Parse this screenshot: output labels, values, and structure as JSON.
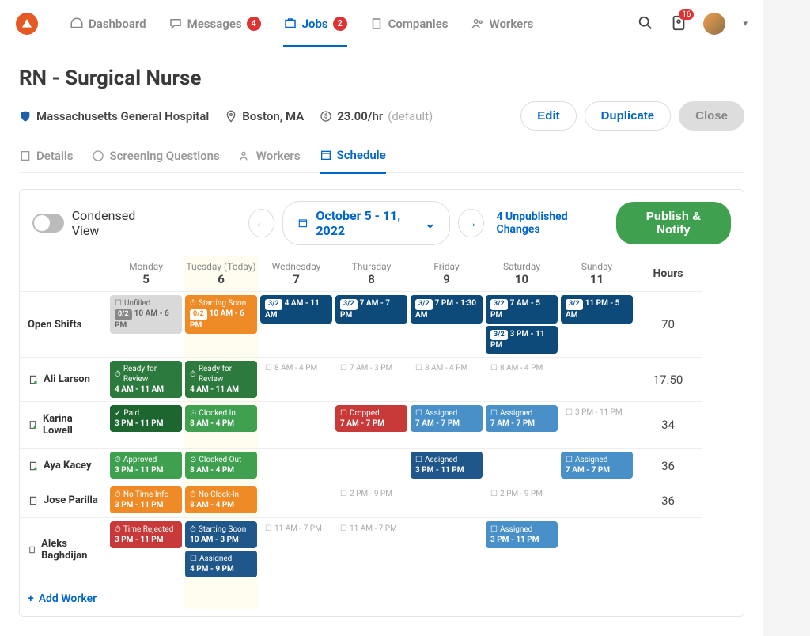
{
  "nav": {
    "dashboard": "Dashboard",
    "messages": "Messages",
    "messages_badge": "4",
    "jobs": "Jobs",
    "jobs_badge": "2",
    "companies": "Companies",
    "workers": "Workers",
    "notif_badge": "16"
  },
  "page": {
    "title": "RN - Surgical Nurse",
    "hospital": "Massachusetts General Hospital",
    "location": "Boston, MA",
    "rate": "23.00/hr",
    "rate_sub": "(default)",
    "edit": "Edit",
    "duplicate": "Duplicate",
    "close": "Close"
  },
  "subtabs": {
    "details": "Details",
    "screening": "Screening Questions",
    "workers": "Workers",
    "schedule": "Schedule"
  },
  "toolbar": {
    "condensed": "Condensed View",
    "range": "October 5 - 11, 2022",
    "unpub": "4 Unpublished Changes",
    "publish": "Publish & Notify"
  },
  "days": [
    {
      "label": "Monday",
      "num": "5"
    },
    {
      "label": "Tuesday (Today)",
      "num": "6"
    },
    {
      "label": "Wednesday",
      "num": "7"
    },
    {
      "label": "Thursday",
      "num": "8"
    },
    {
      "label": "Friday",
      "num": "9"
    },
    {
      "label": "Saturday",
      "num": "10"
    },
    {
      "label": "Sunday",
      "num": "11"
    }
  ],
  "hours_label": "Hours",
  "rows": {
    "open": {
      "label": "Open Shifts",
      "hours": "70",
      "mon": {
        "status": "Unfilled",
        "pill": "0/2",
        "time": "10 AM - 6 PM"
      },
      "tue": {
        "status": "Starting Soon",
        "pill": "0/2",
        "time": "10 AM - 6 PM"
      },
      "wed": {
        "pill": "3/2",
        "time": "4 AM - 11 AM"
      },
      "thu": {
        "pill": "3/2",
        "time": "7 AM - 7 PM"
      },
      "fri": {
        "pill": "3/2",
        "time": "7 PM - 1:30 AM"
      },
      "sat1": {
        "pill": "3/2",
        "time": "7 AM - 5 PM"
      },
      "sat2": {
        "pill": "3/2",
        "time": "3 PM - 11 PM"
      },
      "sun": {
        "pill": "3/2",
        "time": "11 PM - 5 AM"
      }
    },
    "ali": {
      "label": "Ali Larson",
      "hours": "17.50",
      "mon": {
        "status": "Ready for Review",
        "time": "4 AM - 11 AM"
      },
      "tue": {
        "status": "Ready for Review",
        "time": "4 AM - 11 AM"
      },
      "wed": "8 AM - 4 PM",
      "thu": "7 AM - 3 PM",
      "fri": "8 AM - 4 PM",
      "sat": "8 AM - 4 PM"
    },
    "karina": {
      "label": "Karina Lowell",
      "hours": "34",
      "mon": {
        "status": "Paid",
        "time": "3 PM - 11 PM"
      },
      "tue": {
        "status": "Clocked In",
        "time": "8 AM - 4 PM"
      },
      "thu": {
        "status": "Dropped",
        "time": "7 AM - 7 PM"
      },
      "fri": {
        "status": "Assigned",
        "time": "7 AM - 7 PM"
      },
      "sat": {
        "status": "Assigned",
        "time": "7 AM - 7 PM"
      },
      "sun": "3 PM - 11 PM"
    },
    "aya": {
      "label": "Aya Kacey",
      "hours": "36",
      "mon": {
        "status": "Approved",
        "time": "3 PM - 11 PM"
      },
      "tue": {
        "status": "Clocked Out",
        "time": "8 AM - 4 PM"
      },
      "fri": {
        "status": "Assigned",
        "time": "3 PM - 11 PM"
      },
      "sun": {
        "status": "Assigned",
        "time": "7 AM - 7 PM"
      }
    },
    "jose": {
      "label": "Jose Parilla",
      "hours": "36",
      "mon": {
        "status": "No Time Info",
        "time": "3 PM - 11 PM"
      },
      "tue": {
        "status": "No Clock-In",
        "time": "8 AM - 4 PM"
      },
      "thu": "2 PM - 9 PM",
      "sat": "2 PM - 9 PM"
    },
    "aleks": {
      "label": "Aleks Baghdijan",
      "hours": "",
      "mon": {
        "status": "Time Rejected",
        "time": "3 PM - 11 PM"
      },
      "tue1": {
        "status": "Starting Soon",
        "time": "10 AM - 3 PM"
      },
      "tue2": {
        "status": "Assigned",
        "time": "4 PM - 9 PM"
      },
      "wed": "11 AM - 7 PM",
      "thu": "11 AM - 7 PM",
      "sat": {
        "status": "Assigned",
        "time": "3 PM - 11 PM"
      }
    }
  },
  "add_worker": "Add Worker"
}
